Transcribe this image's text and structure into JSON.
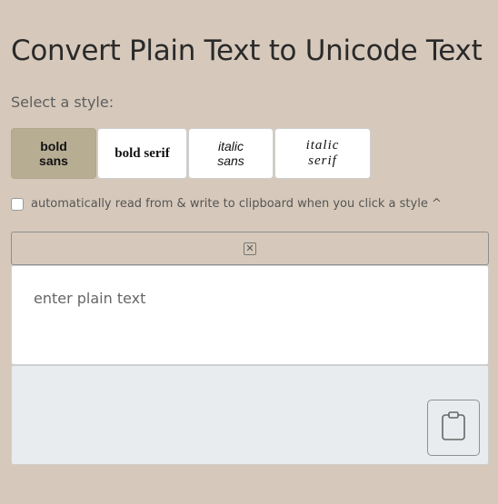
{
  "header": {
    "title": "Convert Plain Text to Unicode Text",
    "subtitle": "Select a style:"
  },
  "styles": [
    {
      "label": "bold sans",
      "selected": true
    },
    {
      "label": "bold serif",
      "selected": false
    },
    {
      "label": "italic sans",
      "selected": false
    },
    {
      "label": "italic serif",
      "selected": false
    }
  ],
  "clipboard": {
    "label": "automatically read from & write to clipboard when you click a style ^",
    "checked": false
  },
  "clear": {
    "icon": "close-icon"
  },
  "input": {
    "placeholder": "enter plain text",
    "value": ""
  },
  "output": {
    "value": "",
    "copy_icon": "clipboard-icon"
  },
  "colors": {
    "background": "#d6c9bb",
    "selected_style": "#b7ad93",
    "output_bg": "#e9ecee"
  }
}
